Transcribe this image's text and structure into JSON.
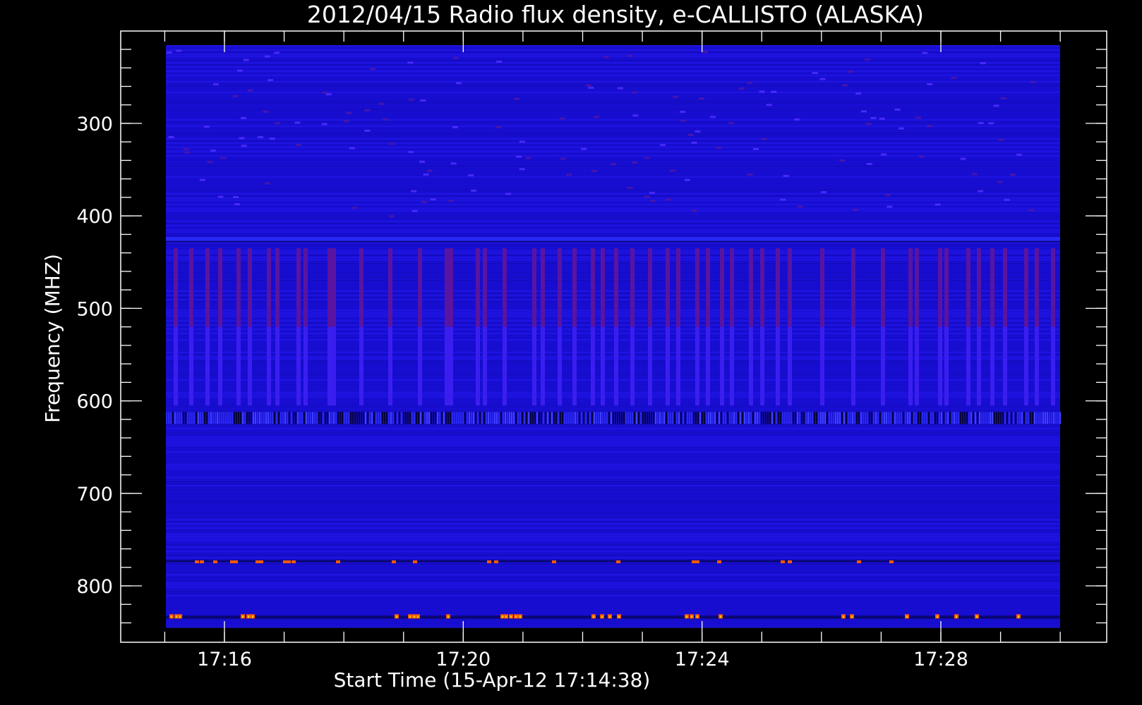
{
  "chart_data": {
    "type": "heatmap",
    "title": "2012/04/15  Radio flux density, e-CALLISTO (ALASKA)",
    "xlabel": "Start Time (15-Apr-12 17:14:38)",
    "ylabel": "Frequency (MHZ)",
    "x_tick_labels": [
      "17:16",
      "17:20",
      "17:24",
      "17:28"
    ],
    "y_tick_labels": [
      "300",
      "400",
      "500",
      "600",
      "700",
      "800"
    ],
    "y_ticks": [
      300,
      400,
      500,
      600,
      700,
      800
    ],
    "ylim": [
      215,
      845
    ],
    "y_inverted": true,
    "grid": false,
    "colors": {
      "background": "#000000",
      "axes": "#ffffff",
      "low_intensity": "#1a10d8",
      "mid_intensity": "#5a14a0",
      "high_intensity": "#ff5a00",
      "peak_intensity": "#ffd200"
    }
  }
}
